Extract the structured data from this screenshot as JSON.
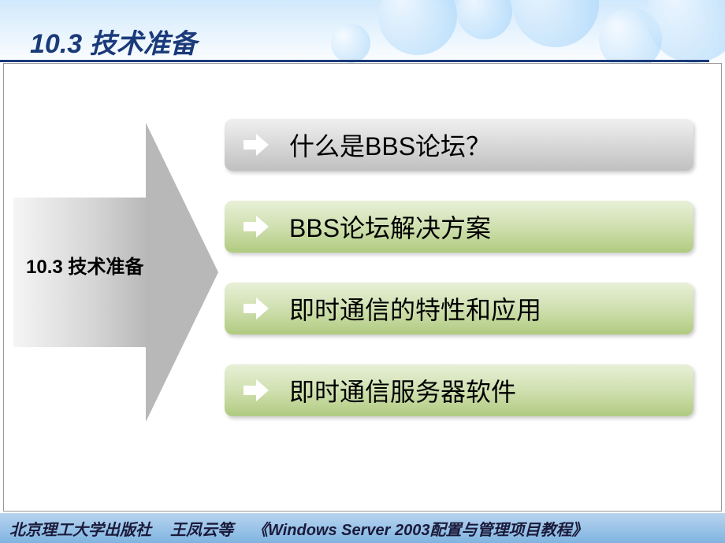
{
  "header": {
    "title": "10.3  技术准备"
  },
  "arrow": {
    "label": "10.3  技术准备"
  },
  "items": [
    {
      "text": "什么是BBS论坛？",
      "style": "gray"
    },
    {
      "text": "BBS论坛解决方案",
      "style": "green"
    },
    {
      "text": "即时通信的特性和应用",
      "style": "green"
    },
    {
      "text": "即时通信服务器软件",
      "style": "green"
    }
  ],
  "footer": {
    "publisher": "北京理工大学出版社",
    "author": "王凤云等",
    "book": "《Windows Server 2003配置与管理项目教程》"
  }
}
